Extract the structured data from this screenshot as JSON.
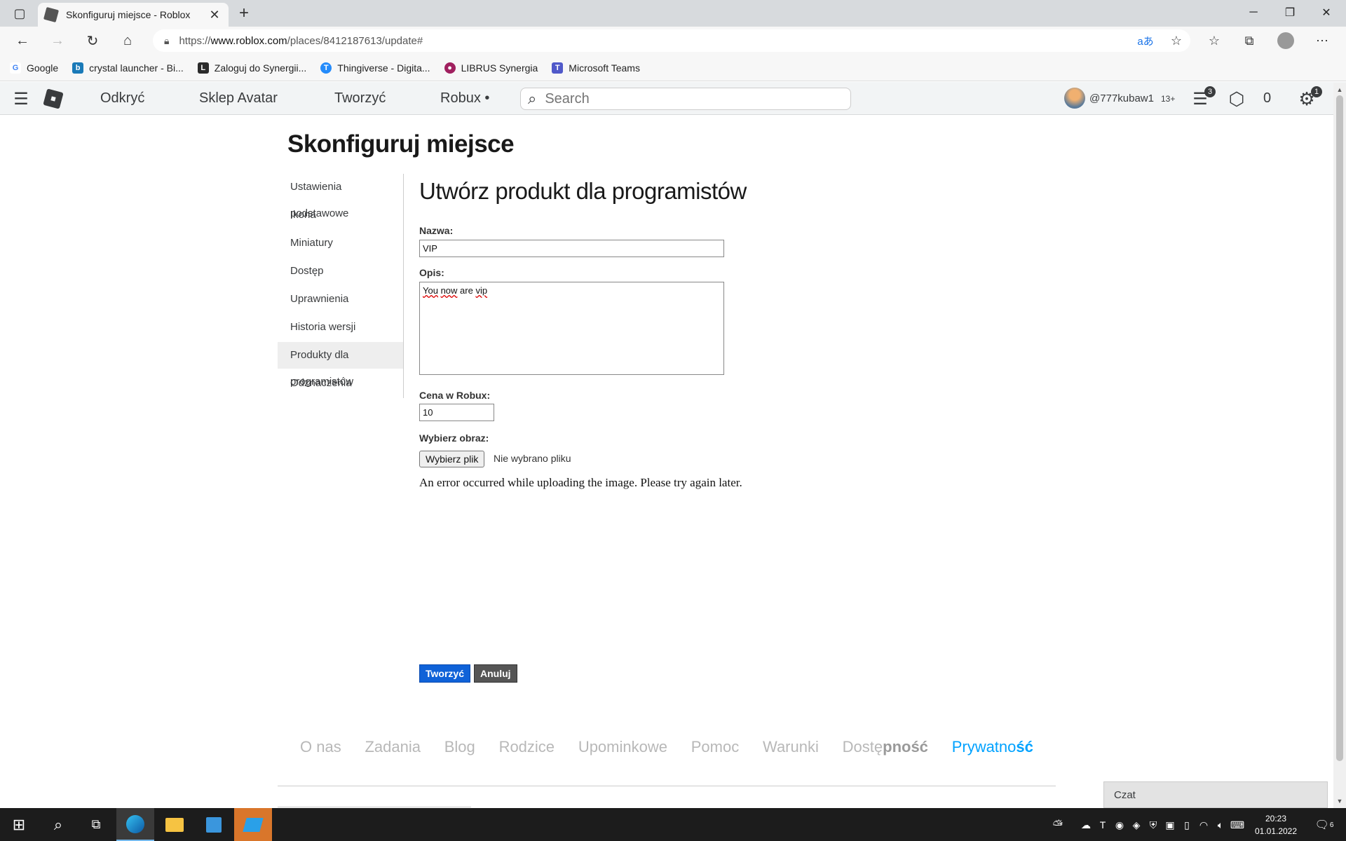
{
  "browser": {
    "tab_title": "Skonfiguruj miejsce - Roblox",
    "url_prefix": "https://",
    "url_host": "www.roblox.com",
    "url_path": "/places/8412187613/update#",
    "bookmarks": [
      {
        "label": "Google",
        "color": "#ffffff",
        "glyph": "G",
        "glyph_color": "#4285f4"
      },
      {
        "label": "crystal launcher - Bi...",
        "color": "#1a7ab8",
        "glyph": "b",
        "glyph_color": "#ffffff"
      },
      {
        "label": "Zaloguj do Synergii...",
        "color": "#2b2b2b",
        "glyph": "L",
        "glyph_color": "#ffffff"
      },
      {
        "label": "Thingiverse - Digita...",
        "color": "#248bfb",
        "glyph": "T",
        "glyph_color": "#ffffff"
      },
      {
        "label": "LIBRUS Synergia",
        "color": "#a0205f",
        "glyph": "●",
        "glyph_color": "#ffffff"
      },
      {
        "label": "Microsoft Teams",
        "color": "#5059c9",
        "glyph": "T",
        "glyph_color": "#ffffff"
      }
    ]
  },
  "header": {
    "nav": [
      "Odkryć",
      "Sklep Avatar",
      "Tworzyć",
      "Robux •"
    ],
    "search_placeholder": "Search",
    "username": "@777kubaw1",
    "age": "13+",
    "messages_badge": "3",
    "settings_badge": "1",
    "robux": "0"
  },
  "page": {
    "title": "Skonfiguruj miejsce",
    "sidebar": {
      "items": [
        "Ustawienia",
        "podstawowe",
        "Ikona",
        "Miniatury",
        "Dostęp",
        "Uprawnienia",
        "Historia wersji",
        "Produkty dla",
        "programistów",
        "Odznaczenia"
      ]
    },
    "form": {
      "title": "Utwórz produkt dla programistów",
      "name_label": "Nazwa:",
      "name_value": "VIP",
      "desc_label": "Opis:",
      "desc_words": [
        "You",
        "now",
        "are",
        "vip"
      ],
      "price_label": "Cena w Robux:",
      "price_value": "10",
      "image_label": "Wybierz obraz:",
      "file_button": "Wybierz plik",
      "file_status": "Nie wybrano pliku",
      "error": "An error occurred while uploading the image. Please try again later.",
      "create_button": "Tworzyć",
      "cancel_button": "Anuluj"
    },
    "footer": {
      "links": [
        "O nas",
        "Zadania",
        "Blog",
        "Rodzice",
        "Upominkowe",
        "Pomoc",
        "Warunki"
      ],
      "accessibility": {
        "normal": "Dostę",
        "bold": "pność"
      },
      "privacy": {
        "normal": "Prywatno",
        "bold": "ść"
      }
    },
    "chat_label": "Czat"
  },
  "taskbar": {
    "time": "20:23",
    "date": "01.01.2022",
    "notification_count": "6"
  }
}
